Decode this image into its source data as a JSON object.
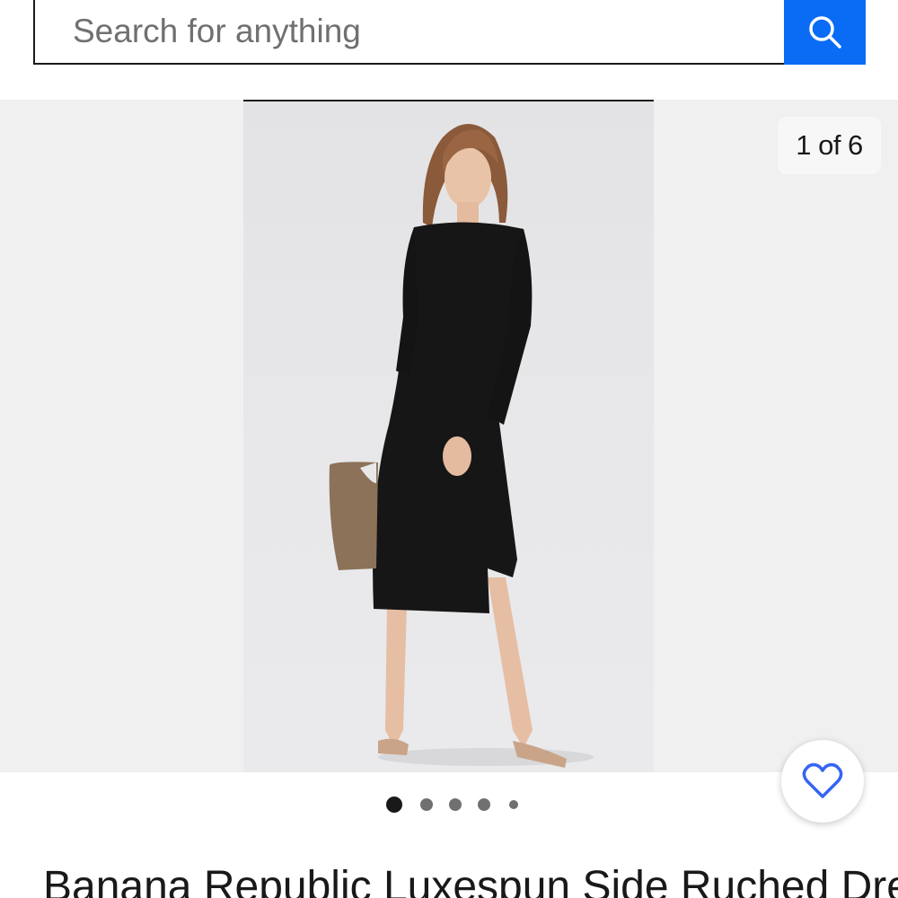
{
  "search": {
    "placeholder": "Search for anything",
    "icon": "search-icon",
    "accent_color": "#0a6cf5"
  },
  "gallery": {
    "counter_text": "1 of 6",
    "current_image": 1,
    "total_images": 6,
    "dots_count": 5,
    "active_dot": 1,
    "watch_icon": "heart-icon"
  },
  "item": {
    "title": "Banana Republic Luxespun Side Ruched Dress"
  }
}
